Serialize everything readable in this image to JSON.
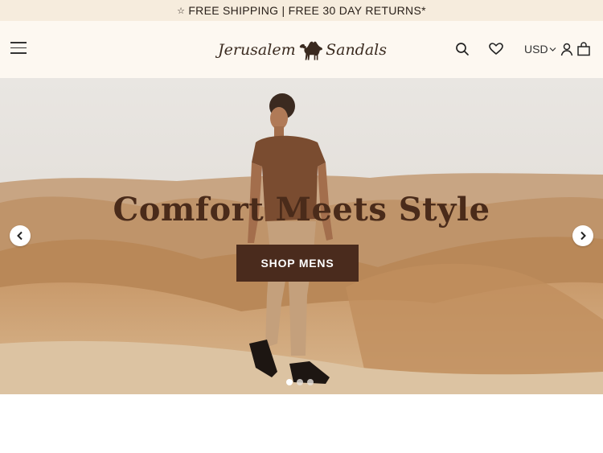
{
  "announcement": {
    "star": "☆",
    "text": "FREE SHIPPING | FREE 30 DAY RETURNS*"
  },
  "header": {
    "logo": {
      "left": "Jerusalem",
      "right": "Sandals"
    },
    "currency": "USD",
    "icons": [
      "menu-icon",
      "search-icon",
      "heart-icon",
      "chevron-down-icon",
      "user-icon",
      "bag-icon"
    ]
  },
  "hero": {
    "title": "Comfort Meets Style",
    "button": "SHOP MENS",
    "prev": "‹",
    "next": "›",
    "slides": 3,
    "active_slide": 1
  },
  "colors": {
    "announcement_bg": "#f6ecdd",
    "header_bg": "#fdf8f1",
    "button_bg": "#4a2b1d",
    "title_color": "#4a2b1a"
  }
}
